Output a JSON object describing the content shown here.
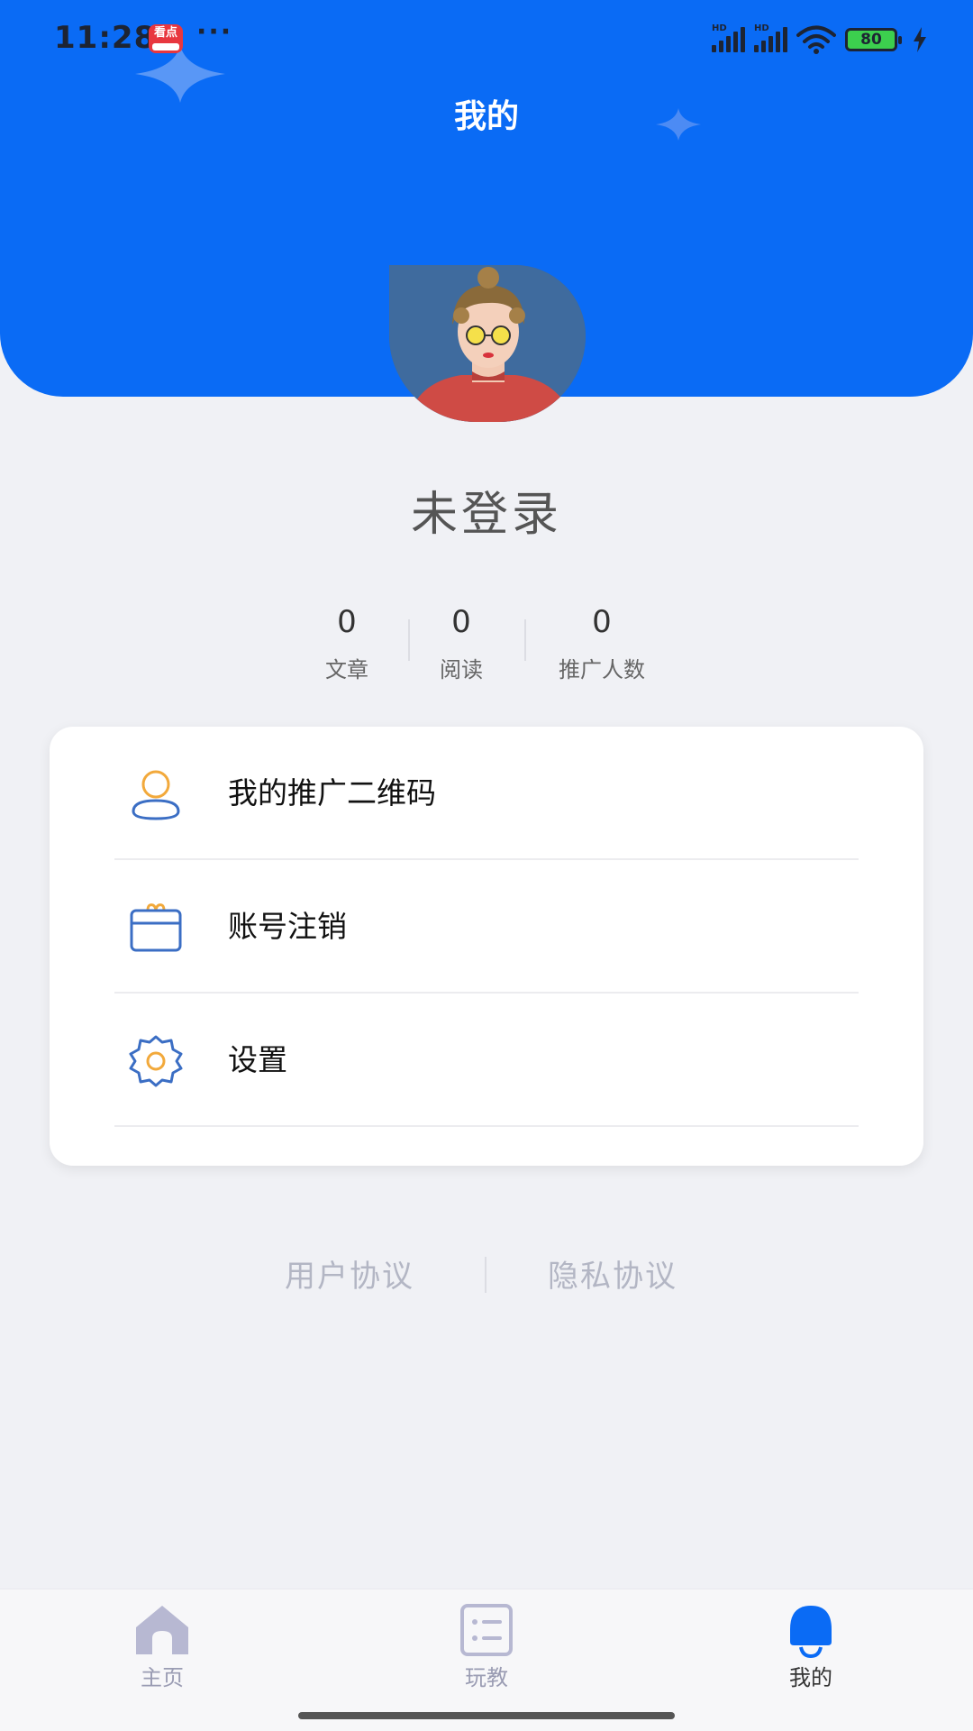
{
  "status_bar": {
    "time": "11:28",
    "app_badge_text": "看点",
    "more": "···",
    "battery": "80"
  },
  "header": {
    "title": "我的"
  },
  "profile": {
    "nickname": "未登录"
  },
  "stats": [
    {
      "value": "0",
      "label": "文章"
    },
    {
      "value": "0",
      "label": "阅读"
    },
    {
      "value": "0",
      "label": "推广人数"
    }
  ],
  "menu": {
    "items": [
      {
        "label": "我的推广二维码",
        "icon": "user-icon"
      },
      {
        "label": "账号注销",
        "icon": "wallet-icon"
      },
      {
        "label": "设置",
        "icon": "gear-icon"
      }
    ]
  },
  "links": {
    "user_agreement": "用户协议",
    "privacy_agreement": "隐私协议"
  },
  "tabbar": {
    "items": [
      {
        "label": "主页",
        "icon": "home-icon"
      },
      {
        "label": "玩教",
        "icon": "list-icon"
      },
      {
        "label": "我的",
        "icon": "bell-icon",
        "active": true
      }
    ]
  },
  "colors": {
    "brand_blue": "#0a6bf5",
    "icon_blue": "#3b6ec4",
    "icon_orange": "#f2a93b",
    "background": "#f0f1f5"
  }
}
